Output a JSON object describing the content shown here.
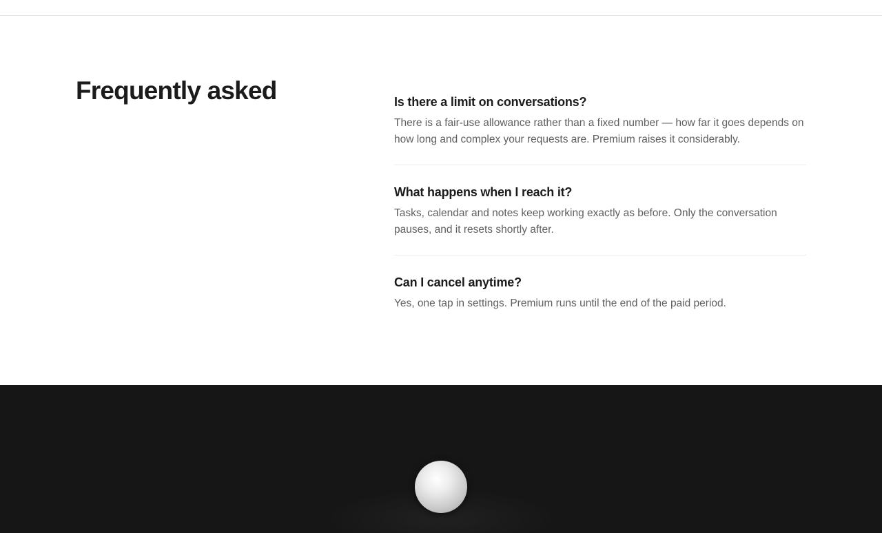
{
  "faq": {
    "title": "Frequently asked",
    "items": [
      {
        "question": "Is there a limit on conversations?",
        "answer": "There is a fair-use allowance rather than a fixed number — how far it goes depends on how long and complex your requests are. Premium raises it considerably."
      },
      {
        "question": "What happens when I reach it?",
        "answer": "Tasks, calendar and notes keep working exactly as before. Only the conversation pauses, and it resets shortly after."
      },
      {
        "question": "Can I cancel anytime?",
        "answer": "Yes, one tap in settings. Premium runs until the end of the paid period."
      }
    ]
  },
  "colors": {
    "heading": "#1b1b1b",
    "body_text": "#5f5f5f",
    "divider": "#ececec",
    "dark_section_bg": "#161616",
    "orb": "#e0e0e0"
  },
  "icons": {
    "orb": "orb-icon"
  }
}
